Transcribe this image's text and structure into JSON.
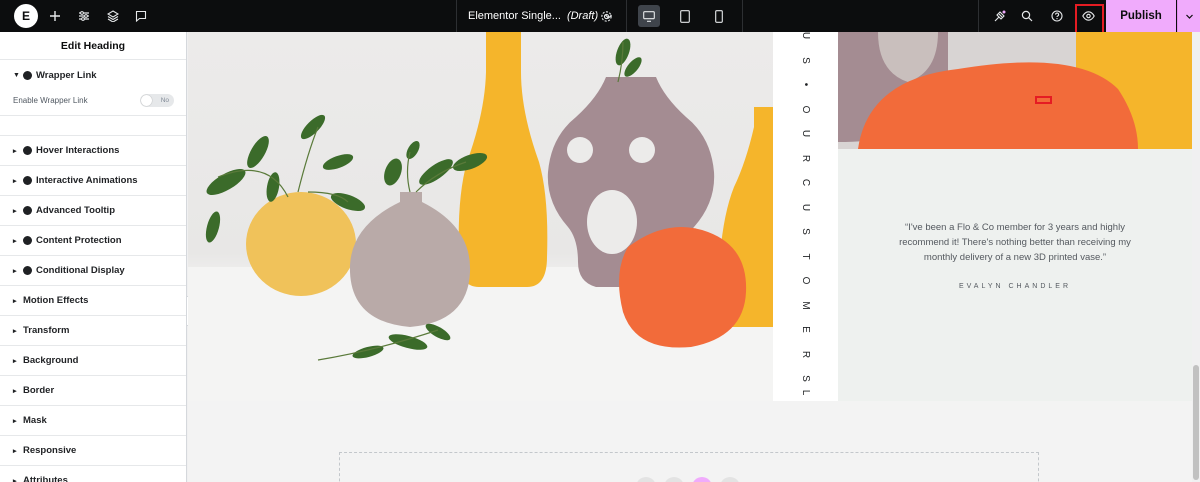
{
  "topbar": {
    "logo_letter": "E",
    "doc_title": "Elementor Single...",
    "doc_status": "(Draft)",
    "publish_label": "Publish",
    "icons": [
      "elementor-logo-icon",
      "add-icon",
      "settings-sliders-icon",
      "structure-icon",
      "comments-icon",
      "chevron-down-icon",
      "gear-icon",
      "desktop-icon",
      "tablet-icon",
      "mobile-icon",
      "whats-new-icon",
      "search-icon",
      "help-icon",
      "eye-icon"
    ]
  },
  "panel": {
    "title": "Edit Heading",
    "wrapper_link": {
      "label": "Wrapper Link",
      "enable_label": "Enable Wrapper Link",
      "toggle_value": "No"
    },
    "sections": [
      {
        "label": "Hover Interactions",
        "badge": true
      },
      {
        "label": "Interactive Animations",
        "badge": true
      },
      {
        "label": "Advanced Tooltip",
        "badge": true
      },
      {
        "label": "Content Protection",
        "badge": true
      },
      {
        "label": "Conditional Display",
        "badge": true
      },
      {
        "label": "Motion Effects",
        "badge": false
      },
      {
        "label": "Transform",
        "badge": false
      },
      {
        "label": "Background",
        "badge": false
      },
      {
        "label": "Border",
        "badge": false
      },
      {
        "label": "Mask",
        "badge": false
      },
      {
        "label": "Responsive",
        "badge": false
      },
      {
        "label": "Attributes",
        "badge": false
      }
    ]
  },
  "canvas": {
    "vertical_letters": [
      "U",
      "S",
      "•",
      "O",
      "U",
      "R",
      "C",
      "U",
      "S",
      "T",
      "O",
      "M",
      "E",
      "R",
      "S",
      "L"
    ],
    "quote": "“I've been a Flo & Co member for 3 years and highly recommend it! There's nothing better than receiving my monthly delivery of a new 3D printed vase.”",
    "author": "EVALYN CHANDLER"
  },
  "colors": {
    "accent_pink": "#f0abfc",
    "highlight_red": "#e51c23",
    "topbar_bg": "#0c0d0e",
    "vase_orange": "#f26b3a",
    "vase_yellow": "#f5b52b",
    "vase_mauve": "#a48c92"
  }
}
